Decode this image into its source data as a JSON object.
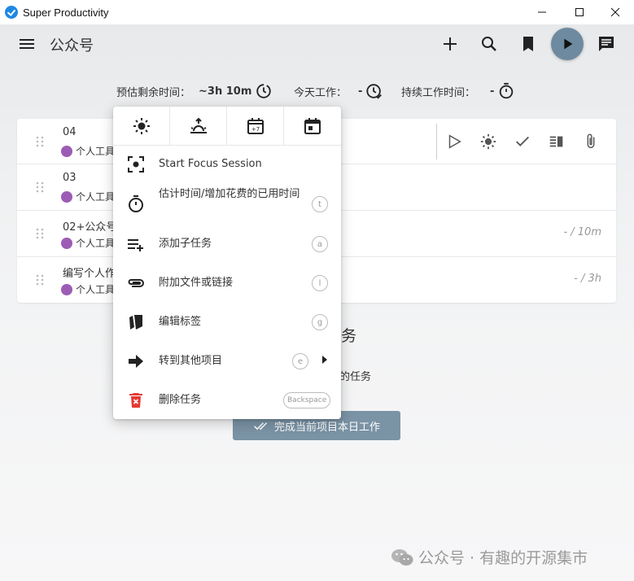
{
  "window": {
    "title": "Super Productivity"
  },
  "toolbar": {
    "project_title": "公众号"
  },
  "stats": {
    "estimate_label": "预估剩余时间：",
    "estimate_value": "~3h 10m",
    "today_label": "今天工作：",
    "today_value": "-",
    "session_label": "持续工作时间：",
    "session_value": "-"
  },
  "tasks": [
    {
      "title": "04",
      "tag": "个人工具",
      "estimate": ""
    },
    {
      "title": "03",
      "tag": "个人工具",
      "estimate": ""
    },
    {
      "title": "02+公众号",
      "tag": "个人工具",
      "estimate": "- / 10m"
    },
    {
      "title": "编写个人作品",
      "tag": "个人工具",
      "estimate": "- / 3h"
    }
  ],
  "empty_state": {
    "title": "务",
    "subtitle": "的任务",
    "finish_button": "完成当前项目本日工作"
  },
  "context_menu": {
    "items": [
      {
        "label": "Start Focus Session",
        "shortcut": ""
      },
      {
        "label": "估计时间/增加花费的已用时间",
        "shortcut": "t"
      },
      {
        "label": "添加子任务",
        "shortcut": "a"
      },
      {
        "label": "附加文件或链接",
        "shortcut": "l"
      },
      {
        "label": "编辑标签",
        "shortcut": "g"
      },
      {
        "label": "转到其他项目",
        "shortcut": "e"
      },
      {
        "label": "删除任务",
        "shortcut": "Backspace"
      }
    ]
  },
  "watermark": {
    "text": "公众号 · 有趣的开源集市"
  },
  "colors": {
    "accent": "#6e8aa0",
    "tag": "#9c5cb4",
    "delete": "#e53935",
    "finish_button": "#7a93a5"
  }
}
